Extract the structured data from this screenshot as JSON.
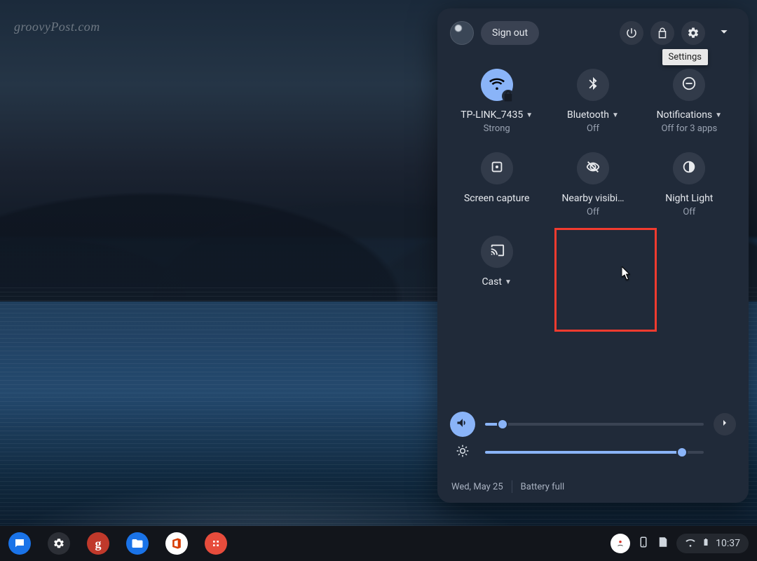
{
  "watermark": "groovyPost.com",
  "qs": {
    "sign_out": "Sign out",
    "tooltip_settings": "Settings",
    "tiles": {
      "wifi": {
        "label": "TP-LINK_7435",
        "sub": "Strong",
        "has_dropdown": true
      },
      "bluetooth": {
        "label": "Bluetooth",
        "sub": "Off",
        "has_dropdown": true
      },
      "notifications": {
        "label": "Notifications",
        "sub": "Off for 3 apps",
        "has_dropdown": true
      },
      "capture": {
        "label": "Screen capture",
        "sub": ""
      },
      "nearby": {
        "label": "Nearby visibi…",
        "sub": "Off"
      },
      "nightlight": {
        "label": "Night Light",
        "sub": "Off"
      },
      "cast": {
        "label": "Cast",
        "sub": "",
        "has_dropdown": true
      }
    },
    "volume_percent": 8,
    "brightness_percent": 90,
    "footer": {
      "date": "Wed, May 25",
      "battery": "Battery full"
    }
  },
  "shelf": {
    "clock": "10:37"
  }
}
